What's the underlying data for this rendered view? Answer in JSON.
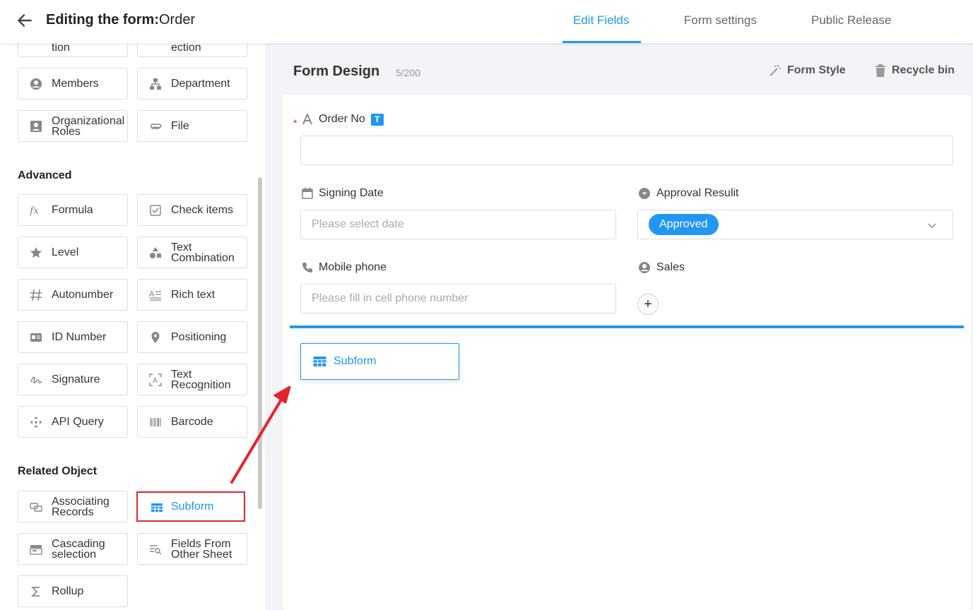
{
  "header": {
    "title_prefix": "Editing the form:",
    "title_name": "Order",
    "tabs": [
      {
        "label": "Edit Fields",
        "active": true
      },
      {
        "label": "Form settings",
        "active": false
      },
      {
        "label": "Public Release",
        "active": false
      }
    ]
  },
  "sidebar": {
    "partial_top": [
      "tion",
      "ection"
    ],
    "basic_controls": [
      {
        "label": "Members",
        "icon": "person-circle-icon"
      },
      {
        "label": "Department",
        "icon": "org-chart-icon"
      },
      {
        "label": "Organizational Roles",
        "icon": "badge-icon"
      },
      {
        "label": "File",
        "icon": "paperclip-icon"
      }
    ],
    "advanced_title": "Advanced",
    "advanced_controls": [
      {
        "label": "Formula",
        "icon": "fx-icon"
      },
      {
        "label": "Check items",
        "icon": "checkbox-icon"
      },
      {
        "label": "Level",
        "icon": "star-icon"
      },
      {
        "label": "Text Combination",
        "icon": "shapes-icon"
      },
      {
        "label": "Autonumber",
        "icon": "hash-icon"
      },
      {
        "label": "Rich text",
        "icon": "rich-text-icon"
      },
      {
        "label": "ID Number",
        "icon": "id-card-icon"
      },
      {
        "label": "Positioning",
        "icon": "location-pin-icon"
      },
      {
        "label": "Signature",
        "icon": "signature-icon"
      },
      {
        "label": "Text Recognition",
        "icon": "text-scan-icon"
      },
      {
        "label": "API Query",
        "icon": "api-icon"
      },
      {
        "label": "Barcode",
        "icon": "barcode-icon"
      }
    ],
    "related_title": "Related Object",
    "related_controls": [
      {
        "label": "Associating Records",
        "icon": "link-records-icon"
      },
      {
        "label": "Subform",
        "icon": "table-grid-icon",
        "selected": true
      },
      {
        "label": "Cascading selection",
        "icon": "cascade-icon"
      },
      {
        "label": "Fields From Other Sheet",
        "icon": "sheet-search-icon"
      },
      {
        "label": "Rollup",
        "icon": "sigma-icon"
      }
    ]
  },
  "main": {
    "title": "Form Design",
    "count": "5/200",
    "form_style_label": "Form Style",
    "recycle_bin_label": "Recycle bin",
    "fields": {
      "order_no": {
        "label": "Order No",
        "required_mark": "*",
        "badge": "T",
        "value": ""
      },
      "signing_date": {
        "label": "Signing Date",
        "placeholder": "Please select date"
      },
      "approval_result": {
        "label": "Approval Resulit",
        "value": "Approved"
      },
      "mobile_phone": {
        "label": "Mobile phone",
        "placeholder": "Please fill in cell phone number"
      },
      "sales": {
        "label": "Sales",
        "add_label": "+"
      }
    },
    "dragged_item": {
      "label": "Subform"
    }
  },
  "colors": {
    "accent": "#2196f3",
    "highlight": "#e0262f"
  }
}
